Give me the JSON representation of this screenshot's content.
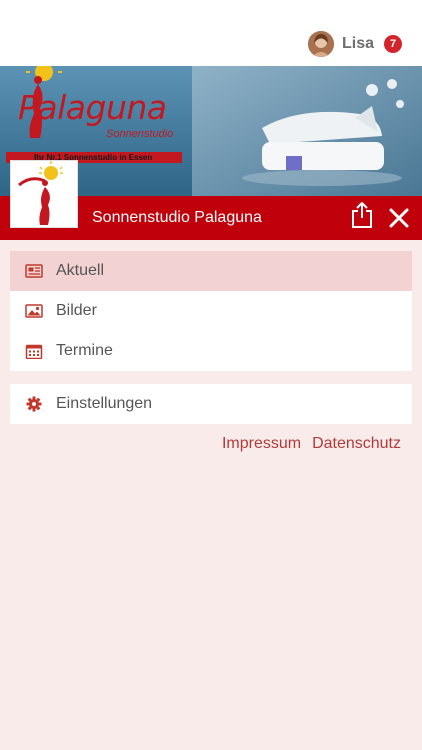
{
  "user": {
    "name": "Lisa",
    "notifications": "7"
  },
  "banner": {
    "brand": "Palaguna",
    "sub": "Sonnenstudio",
    "strip": "Ihr Nr.1 Sonnenstudio in Essen"
  },
  "header": {
    "title": "Sonnenstudio Palaguna"
  },
  "menu_main": [
    {
      "label": "Aktuell",
      "icon": "news-icon",
      "active": true
    },
    {
      "label": "Bilder",
      "icon": "image-icon",
      "active": false
    },
    {
      "label": "Termine",
      "icon": "calendar-icon",
      "active": false
    }
  ],
  "menu_settings": {
    "label": "Einstellungen",
    "icon": "gear-icon"
  },
  "footer_links": {
    "impressum": "Impressum",
    "datenschutz": "Datenschutz"
  },
  "colors": {
    "accent": "#c0000a",
    "active_bg": "#f2d2d2",
    "page_bg": "#f9ebea",
    "link": "#b03b3b",
    "badge": "#d3242b"
  }
}
